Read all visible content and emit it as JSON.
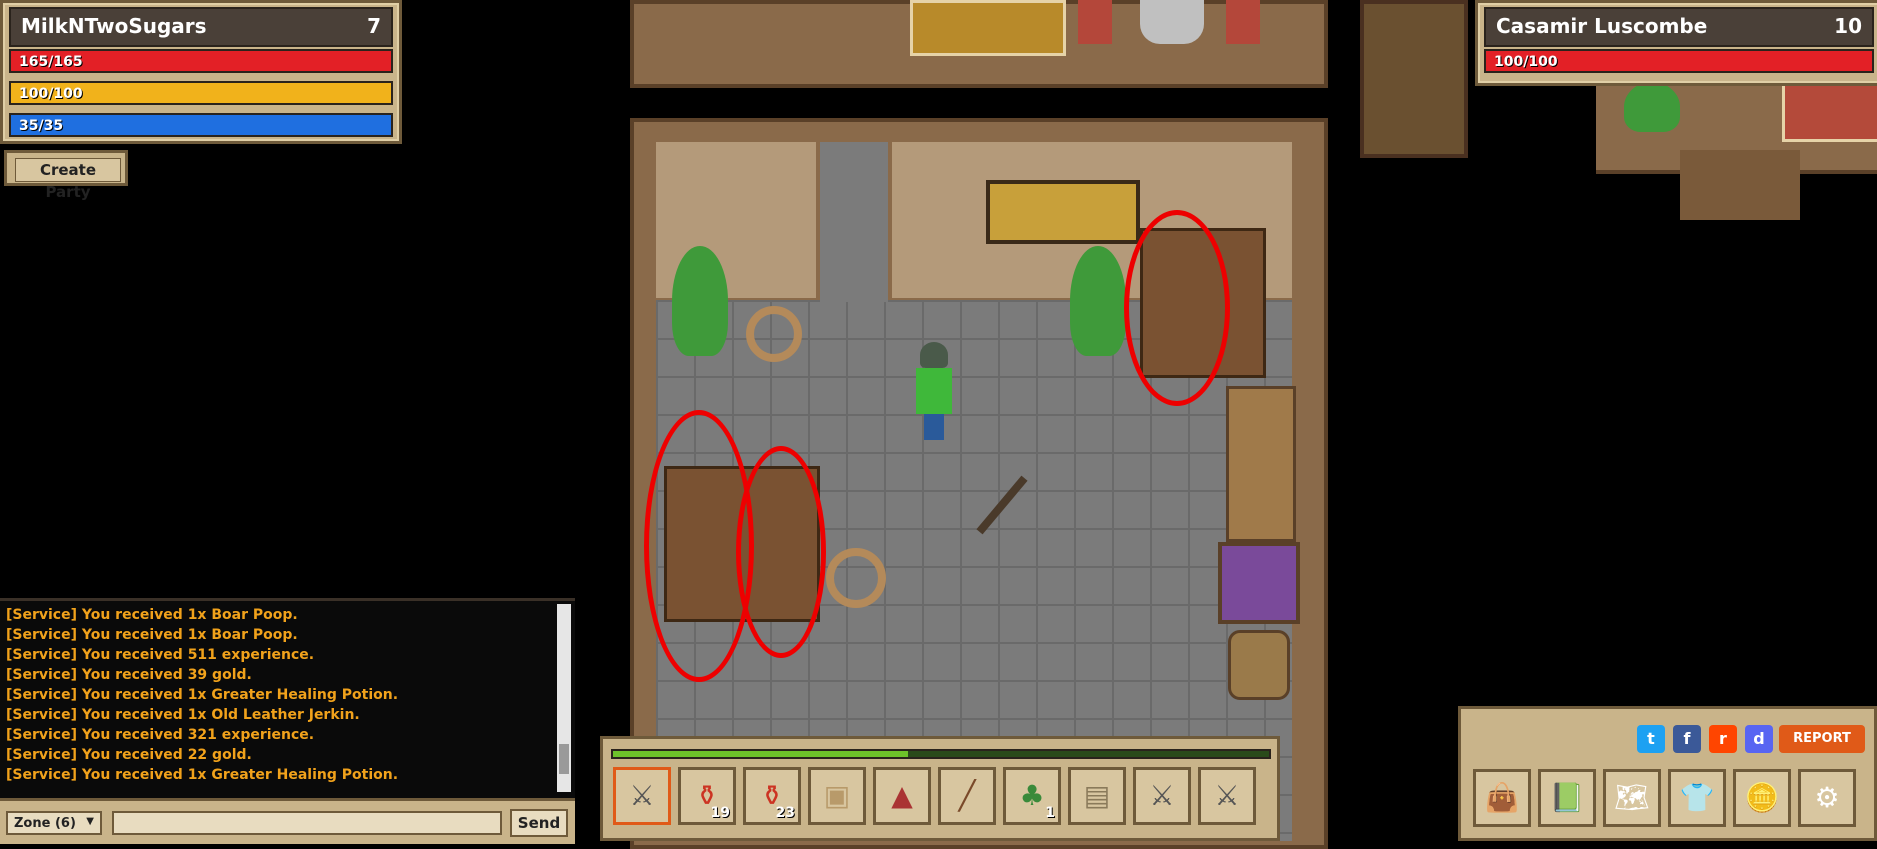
{
  "player": {
    "name": "MilkNTwoSugars",
    "level": "7",
    "health": "165/165",
    "health_fraction": 1.0,
    "energy": "100/100",
    "energy_fraction": 1.0,
    "mana": "35/35",
    "mana_fraction": 1.0
  },
  "party": {
    "create_label": "Create Party"
  },
  "target": {
    "name": "Casamir Luscombe",
    "level": "10",
    "health": "100/100",
    "health_fraction": 1.0
  },
  "chat": {
    "lines": [
      "[Service] You received 1x Boar Poop.",
      "[Service] You received 1x Boar Poop.",
      "[Service] You received 511 experience.",
      "[Service] You received 39 gold.",
      "[Service] You received 1x Greater Healing Potion.",
      "[Service] You received 1x Old Leather Jerkin.",
      "[Service] You received 321 experience.",
      "[Service] You received 22 gold.",
      "[Service] You received 1x Greater Healing Potion."
    ],
    "zone_selected": "Zone (6)",
    "input_value": "",
    "send_label": "Send"
  },
  "hotbar": {
    "experience_fraction": 0.45,
    "slots": [
      {
        "icon": "sword-icon",
        "count": ""
      },
      {
        "icon": "red-potion-icon",
        "count": "19"
      },
      {
        "icon": "red-potion-icon",
        "count": "23"
      },
      {
        "icon": "leather-armor-icon",
        "count": ""
      },
      {
        "icon": "red-hat-icon",
        "count": ""
      },
      {
        "icon": "club-icon",
        "count": ""
      },
      {
        "icon": "herb-icon",
        "count": "1"
      },
      {
        "icon": "map-scroll-icon",
        "count": ""
      },
      {
        "icon": "sword-icon",
        "count": ""
      },
      {
        "icon": "sword-icon",
        "count": ""
      }
    ]
  },
  "menu": {
    "report_label": "REPORT",
    "social": [
      "twitter-icon",
      "facebook-icon",
      "reddit-icon",
      "discord-icon"
    ],
    "buttons": [
      "bag-icon",
      "book-icon",
      "world-map-icon",
      "character-icon",
      "gold-icon",
      "settings-icon"
    ]
  },
  "colors": {
    "health": "#e32026",
    "energy": "#f1b21b",
    "mana": "#1f6fe0",
    "chat_text": "#f1a21b",
    "highlight_circle": "#ee0000"
  }
}
